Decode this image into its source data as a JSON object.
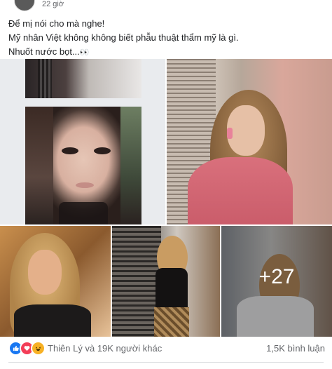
{
  "post": {
    "timestamp": "22 giờ",
    "lines": [
      "Để mị nói cho mà nghe!",
      "Mỹ nhân Việt không không biết phẫu thuật thẩm mỹ là gì.",
      "Nhuốt nước bọt..."
    ],
    "emoji": "👀"
  },
  "photos": {
    "more_count": "+27"
  },
  "footer": {
    "reactions_text": "Thiên Lý và 19K người khác",
    "comments_text": "1,5K bình luận",
    "reaction_icons": [
      "like-icon",
      "love-icon",
      "haha-icon"
    ]
  },
  "colors": {
    "like": "#1877f2",
    "love": "#f33e58",
    "haha": "#f7b125",
    "meta_text": "#65676b"
  }
}
